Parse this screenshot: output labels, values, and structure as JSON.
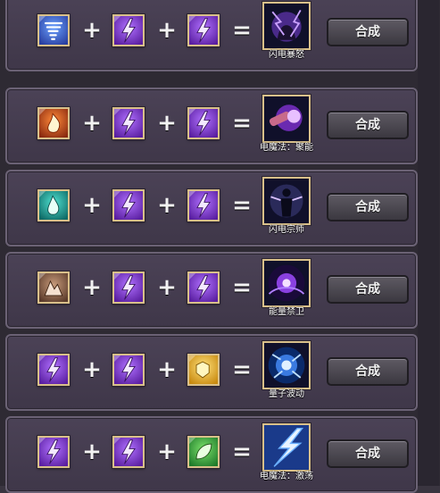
{
  "colors": {
    "lightning": "#8b3fd0",
    "gold_border": "#d9c08a",
    "button": "#4a464f"
  },
  "rows": [
    {
      "icons": [
        "tornado-gem-icon",
        "lightning-gem-icon",
        "lightning-gem-icon"
      ],
      "ops": [
        "+",
        "+",
        "="
      ],
      "result_icon": "thunder-fury-icon",
      "result_label": "闪电暴怒",
      "button": "合成"
    },
    {
      "icons": [
        "fire-gem-icon",
        "lightning-gem-icon",
        "lightning-gem-icon"
      ],
      "ops": [
        "+",
        "+",
        "="
      ],
      "result_icon": "electro-charge-icon",
      "result_label": "电魔法：聚能",
      "button": "合成"
    },
    {
      "icons": [
        "water-gem-icon",
        "lightning-gem-icon",
        "lightning-gem-icon"
      ],
      "ops": [
        "+",
        "+",
        "="
      ],
      "result_icon": "lightning-master-icon",
      "result_label": "闪电宗师",
      "button": "合成"
    },
    {
      "icons": [
        "earth-gem-icon",
        "lightning-gem-icon",
        "lightning-gem-icon"
      ],
      "ops": [
        "+",
        "+",
        "="
      ],
      "result_icon": "energy-guard-icon",
      "result_label": "能量禁卫",
      "button": "合成"
    },
    {
      "icons": [
        "lightning-gem-icon",
        "lightning-gem-icon",
        "light-gem-icon"
      ],
      "ops": [
        "+",
        "+",
        "="
      ],
      "result_icon": "quantum-wave-icon",
      "result_label": "量子波动",
      "button": "合成"
    },
    {
      "icons": [
        "lightning-gem-icon",
        "lightning-gem-icon",
        "nature-gem-icon"
      ],
      "ops": [
        "+",
        "+",
        "="
      ],
      "result_icon": "electro-surge-icon",
      "result_label": "电魔法：激荡",
      "button": "合成"
    }
  ]
}
